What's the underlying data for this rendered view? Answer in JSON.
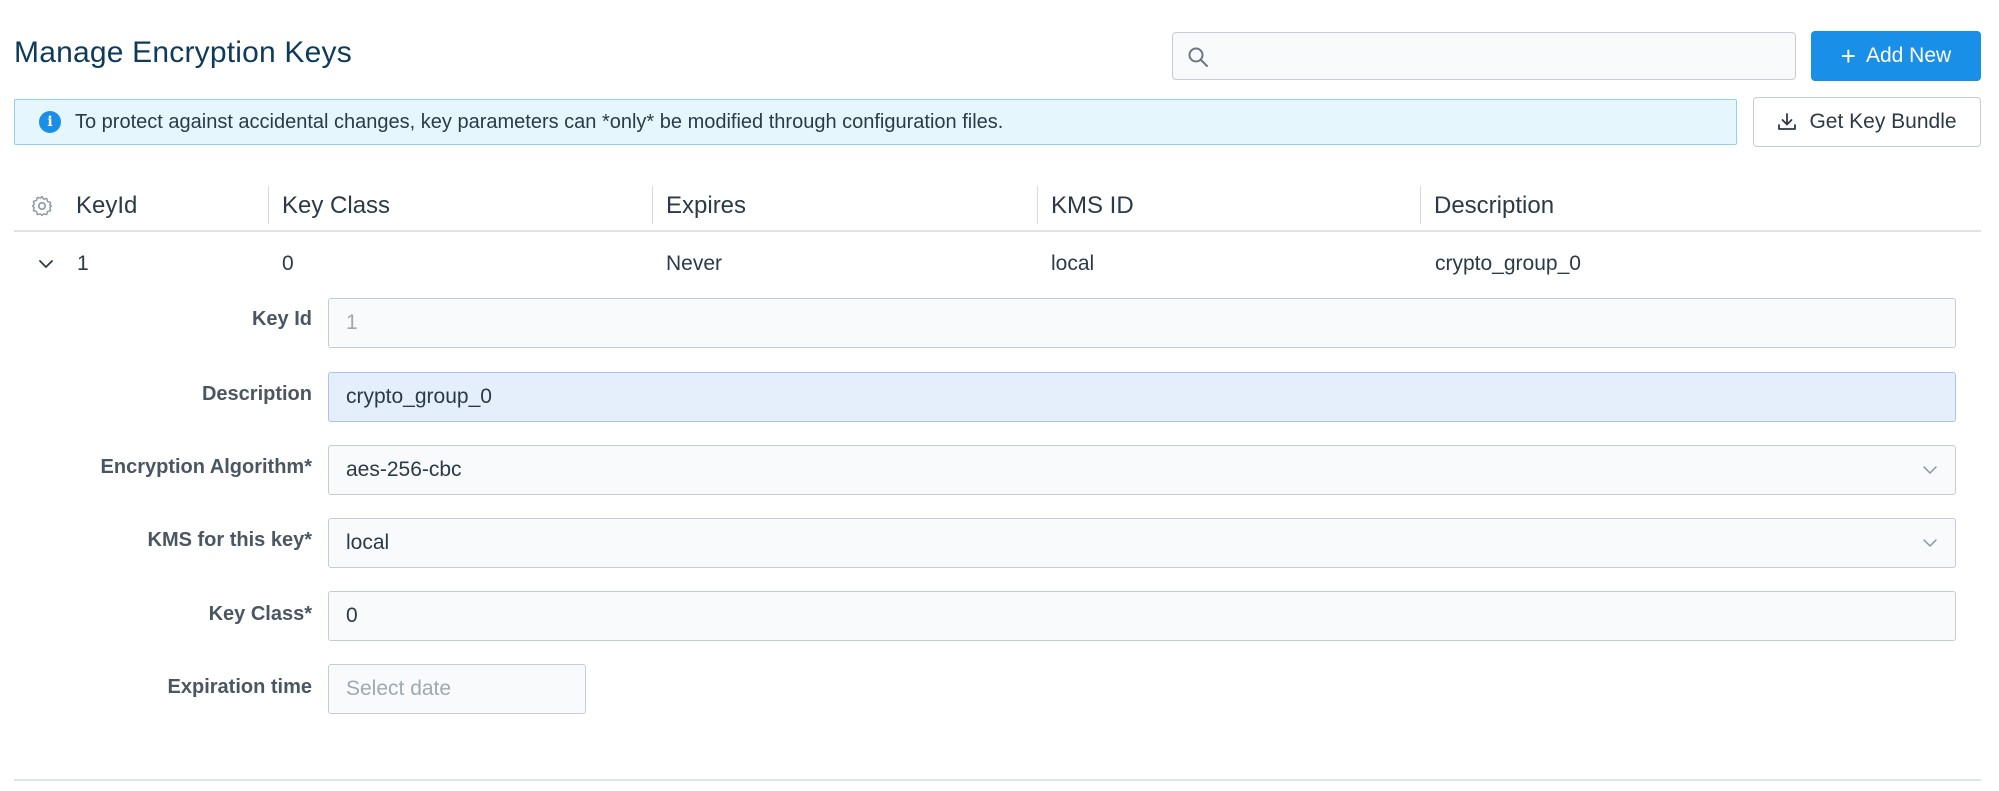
{
  "page": {
    "title": "Manage Encryption Keys"
  },
  "toolbar": {
    "search_value": "",
    "search_placeholder": "",
    "add_new_label": "Add New",
    "get_key_bundle_label": "Get Key Bundle"
  },
  "banner": {
    "text": "To protect against accidental changes, key parameters can *only* be modified through configuration files."
  },
  "table": {
    "columns": [
      "KeyId",
      "Key Class",
      "Expires",
      "KMS ID",
      "Description"
    ],
    "rows": [
      {
        "key_id": "1",
        "key_class": "0",
        "expires": "Never",
        "kms_id": "local",
        "description": "crypto_group_0"
      }
    ]
  },
  "details": {
    "key_id": {
      "label": "Key Id",
      "value": "1"
    },
    "description": {
      "label": "Description",
      "value": "crypto_group_0"
    },
    "encryption_algorithm": {
      "label": "Encryption Algorithm*",
      "value": "aes-256-cbc"
    },
    "kms": {
      "label": "KMS for this key*",
      "value": "local"
    },
    "key_class": {
      "label": "Key Class*",
      "value": "0"
    },
    "expiration_time": {
      "label": "Expiration time",
      "placeholder": "Select date"
    }
  },
  "icons": {
    "search": "search-icon",
    "add": "plus-icon",
    "info": "info-icon",
    "download": "download-icon",
    "settings": "gear-icon",
    "expand": "chevron-down-icon",
    "dropdown": "chevron-down-icon"
  },
  "colors": {
    "primary": "#1a8fe8",
    "title": "#0e3a5b",
    "banner_bg": "#e6f6fd",
    "banner_border": "#8fd3ee",
    "focused_input": "#e4effb"
  }
}
